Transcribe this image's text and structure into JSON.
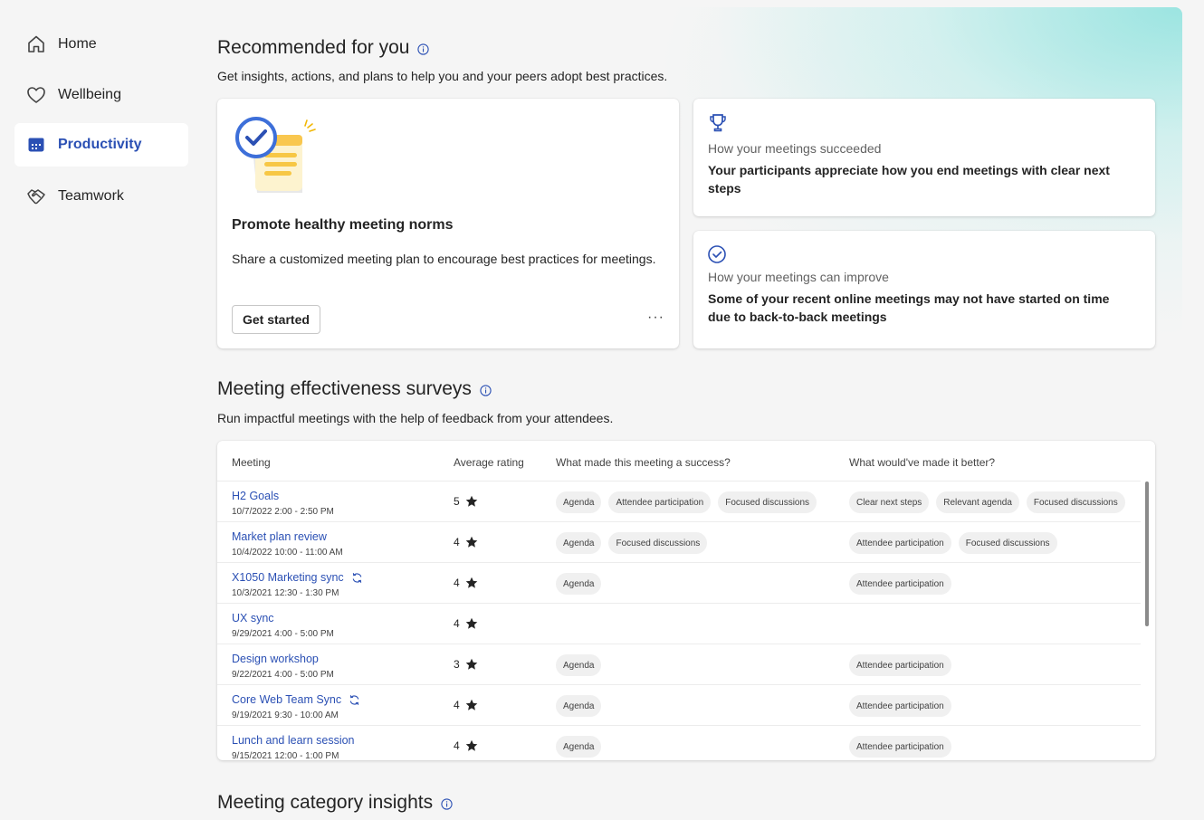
{
  "sidebar": {
    "items": [
      {
        "label": "Home",
        "icon": "home-icon"
      },
      {
        "label": "Wellbeing",
        "icon": "heart-icon"
      },
      {
        "label": "Productivity",
        "icon": "calendar-icon",
        "active": true
      },
      {
        "label": "Teamwork",
        "icon": "handshake-icon"
      }
    ]
  },
  "recommended": {
    "title": "Recommended for you",
    "subtitle": "Get insights, actions, and plans to help you and your peers adopt best practices.",
    "plan_card": {
      "title": "Promote healthy meeting norms",
      "text": "Share a customized meeting plan to encourage best practices for meetings.",
      "button": "Get started",
      "more": "···"
    },
    "insights": [
      {
        "icon": "trophy-icon",
        "label": "How your meetings succeeded",
        "text": "Your participants appreciate how you end meetings with clear next steps"
      },
      {
        "icon": "check-circle-icon",
        "label": "How your meetings can improve",
        "text": "Some of your recent online meetings may not have started on time due to back-to-back meetings"
      }
    ]
  },
  "surveys": {
    "title": "Meeting effectiveness surveys",
    "subtitle": "Run impactful meetings with the help of feedback from your attendees.",
    "columns": [
      "Meeting",
      "Average rating",
      "What made this meeting a success?",
      "What would've made it better?"
    ],
    "rows": [
      {
        "title": "H2 Goals",
        "date": "10/7/2022  2:00 - 2:50 PM",
        "rating": "5",
        "recurring": false,
        "success": [
          "Agenda",
          "Attendee participation",
          "Focused discussions"
        ],
        "better": [
          "Clear next steps",
          "Relevant agenda",
          "Focused discussions"
        ]
      },
      {
        "title": "Market plan review",
        "date": "10/4/2022  10:00 - 11:00 AM",
        "rating": "4",
        "recurring": false,
        "success": [
          "Agenda",
          "Focused discussions"
        ],
        "better": [
          "Attendee participation",
          "Focused discussions"
        ]
      },
      {
        "title": "X1050 Marketing sync",
        "date": "10/3/2021  12:30 - 1:30 PM",
        "rating": "4",
        "recurring": true,
        "success": [
          "Agenda"
        ],
        "better": [
          "Attendee participation"
        ]
      },
      {
        "title": "UX sync",
        "date": "9/29/2021  4:00 - 5:00 PM",
        "rating": "4",
        "recurring": false,
        "success": [],
        "better": []
      },
      {
        "title": "Design workshop",
        "date": "9/22/2021  4:00 - 5:00 PM",
        "rating": "3",
        "recurring": false,
        "success": [
          "Agenda"
        ],
        "better": [
          "Attendee participation"
        ]
      },
      {
        "title": "Core Web Team Sync",
        "date": "9/19/2021  9:30 - 10:00 AM",
        "rating": "4",
        "recurring": true,
        "success": [
          "Agenda"
        ],
        "better": [
          "Attendee participation"
        ]
      },
      {
        "title": "Lunch and learn session",
        "date": "9/15/2021  12:00 - 1:00 PM",
        "rating": "4",
        "recurring": false,
        "success": [
          "Agenda"
        ],
        "better": [
          "Attendee participation"
        ]
      }
    ]
  },
  "category": {
    "title": "Meeting category insights"
  },
  "colors": {
    "accent": "#2b50b4",
    "teal": "#8fe2de"
  }
}
